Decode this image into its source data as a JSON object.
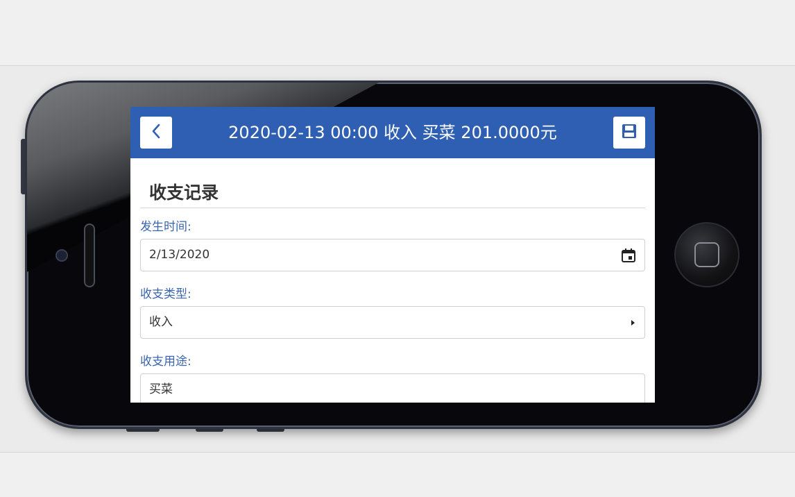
{
  "header": {
    "title": "2020-02-13 00:00 收入 买菜 201.0000元",
    "back_icon": "chevron-left-icon",
    "save_icon": "save-icon"
  },
  "form": {
    "section_title": "收支记录",
    "fields": [
      {
        "label": "发生时间:",
        "value": "2/13/2020",
        "icon": "calendar-icon"
      },
      {
        "label": "收支类型:",
        "value": "收入",
        "icon": "caret-right-icon"
      },
      {
        "label": "收支用途:",
        "value": "买菜"
      }
    ]
  },
  "colors": {
    "accent": "#2f5fb3",
    "label": "#3a65b0"
  }
}
